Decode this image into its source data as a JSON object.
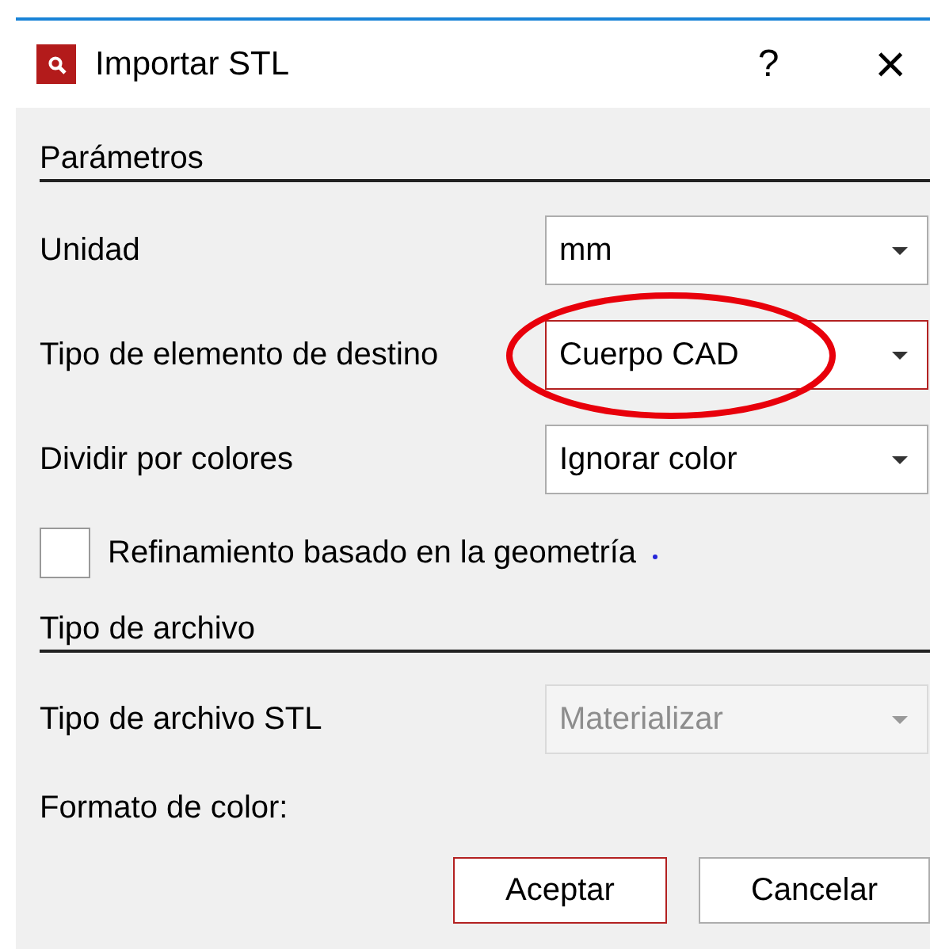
{
  "window": {
    "title": "Importar STL",
    "help": "?",
    "close": "×"
  },
  "sections": [
    {
      "title": "Parámetros",
      "items": [
        {
          "kind": "dropdown",
          "label": "Unidad",
          "value": "mm",
          "focused": false,
          "disabled": false,
          "circled": false
        },
        {
          "kind": "dropdown",
          "label": "Tipo de elemento de destino",
          "value": "Cuerpo CAD",
          "focused": true,
          "disabled": false,
          "circled": true
        },
        {
          "kind": "dropdown",
          "label": "Dividir por colores",
          "value": "Ignorar color",
          "focused": false,
          "disabled": false,
          "circled": false
        },
        {
          "kind": "checkbox",
          "label": "Refinamiento basado en la geometría",
          "checked": false
        }
      ]
    },
    {
      "title": "Tipo de archivo",
      "items": [
        {
          "kind": "dropdown",
          "label": "Tipo de archivo STL",
          "value": "Materializar",
          "focused": false,
          "disabled": true,
          "circled": false
        },
        {
          "kind": "text",
          "label": "Formato de color:"
        }
      ]
    }
  ],
  "buttons": [
    {
      "label": "Aceptar",
      "default": true
    },
    {
      "label": "Cancelar",
      "default": false
    }
  ]
}
